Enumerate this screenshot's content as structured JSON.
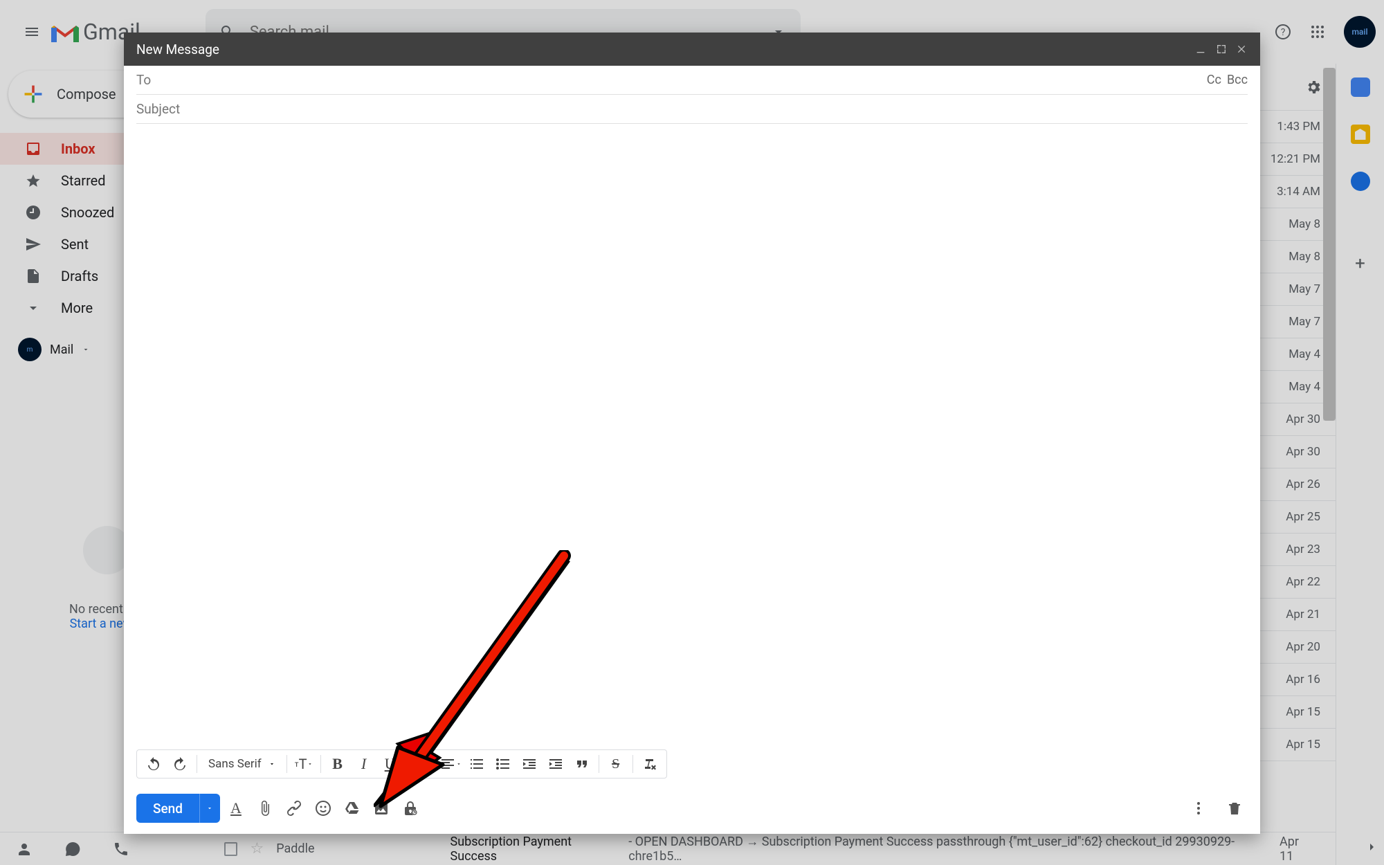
{
  "header": {
    "brand": "Gmail",
    "search_placeholder": "Search mail",
    "avatar_text": "mail"
  },
  "sidebar": {
    "compose": "Compose",
    "items": [
      {
        "label": "Inbox",
        "icon": "inbox"
      },
      {
        "label": "Starred",
        "icon": "star"
      },
      {
        "label": "Snoozed",
        "icon": "clock"
      },
      {
        "label": "Sent",
        "icon": "send"
      },
      {
        "label": "Drafts",
        "icon": "draft"
      },
      {
        "label": "More",
        "icon": "more"
      }
    ],
    "mail_label": "Mail",
    "no_chats_line1": "No recent c",
    "no_chats_line2": "Start a new"
  },
  "mail_dates": [
    "1:43 PM",
    "12:21 PM",
    "3:14 AM",
    "May 8",
    "May 8",
    "May 7",
    "May 7",
    "May 4",
    "May 4",
    "Apr 30",
    "Apr 30",
    "Apr 26",
    "Apr 25",
    "Apr 23",
    "Apr 22",
    "Apr 21",
    "Apr 20",
    "Apr 16",
    "Apr 15",
    "Apr 15"
  ],
  "bottom_mail": {
    "sender": "Paddle",
    "subject": "Subscription Payment Success",
    "body": " - OPEN DASHBOARD → Subscription Payment Success passthrough {\"mt_user_id\":62} checkout_id 29930929-chre1b5…",
    "date": "Apr 11"
  },
  "compose": {
    "title": "New Message",
    "to": "To",
    "cc": "Cc",
    "bcc": "Bcc",
    "subject": "Subject",
    "font_name": "Sans Serif",
    "send": "Send"
  }
}
